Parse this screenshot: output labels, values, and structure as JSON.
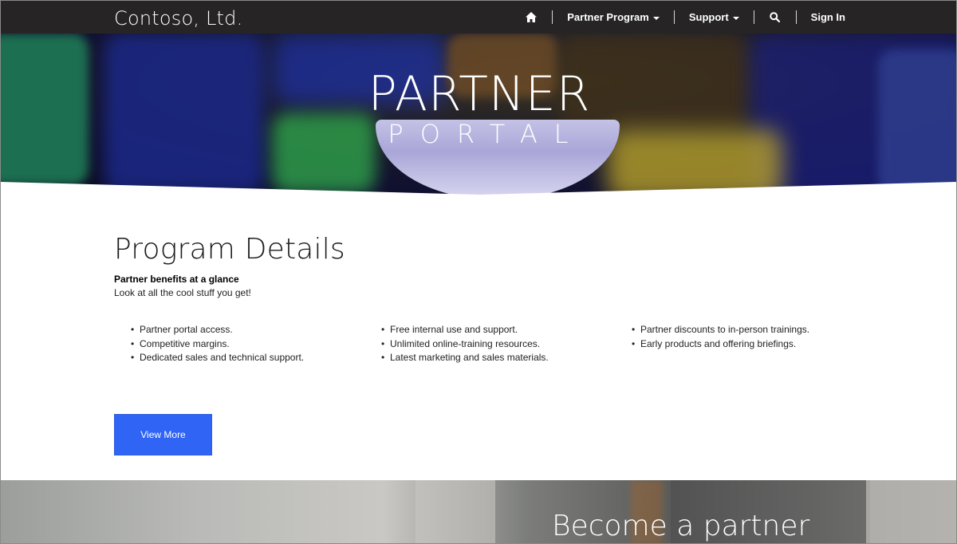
{
  "header": {
    "brand": "Contoso, Ltd.",
    "nav": {
      "home_icon": "home-icon",
      "partner_program": "Partner Program",
      "support": "Support",
      "search_icon": "search-icon",
      "sign_in": "Sign In"
    }
  },
  "hero": {
    "title": "PARTNER",
    "subtitle": "PORTAL"
  },
  "main": {
    "title": "Program Details",
    "subtitle": "Partner benefits at a glance",
    "description": "Look at all the cool stuff you get!",
    "benefits": [
      [
        "Partner portal access.",
        "Competitive margins.",
        "Dedicated sales and technical support."
      ],
      [
        "Free internal use and support.",
        "Unlimited online-training resources.",
        "Latest marketing and sales materials."
      ],
      [
        "Partner discounts to in-person trainings.",
        "Early products and offering briefings."
      ]
    ],
    "button": "View More"
  },
  "band": {
    "title": "Become a partner"
  },
  "colors": {
    "nav_bg": "#262424",
    "button_bg": "#2f64f4"
  }
}
